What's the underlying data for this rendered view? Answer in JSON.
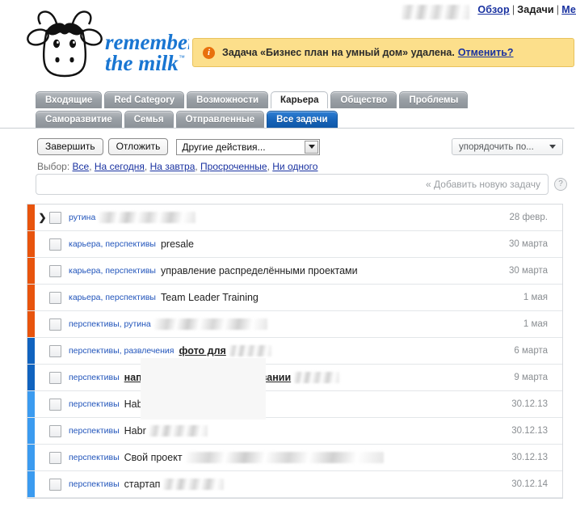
{
  "header": {
    "logo_alt": "remember the milk",
    "logo_line1": "remember",
    "logo_line2": "the milk",
    "username_redacted": "",
    "nav": [
      {
        "label": "Обзор",
        "link": true
      },
      {
        "label": "Задачи",
        "link": false
      },
      {
        "label": "Ме",
        "link": true
      }
    ],
    "nav_separator": "|"
  },
  "notice": {
    "icon": "info-icon",
    "icon_glyph": "i",
    "text": "Задача «Бизнес план на умный дом» удалена.",
    "undo_label": "Отменить?",
    "bg_color": "#fcdf8b",
    "border_color": "#e8c25c",
    "icon_color": "#e8700d"
  },
  "tabs": {
    "row1": [
      {
        "label": "Входящие",
        "state": "normal"
      },
      {
        "label": "Red Category",
        "state": "normal"
      },
      {
        "label": "Возможности",
        "state": "normal"
      },
      {
        "label": "Карьера",
        "state": "active-white"
      },
      {
        "label": "Общество",
        "state": "normal"
      },
      {
        "label": "Проблемы",
        "state": "normal"
      }
    ],
    "row2": [
      {
        "label": "Саморазвитие",
        "state": "normal"
      },
      {
        "label": "Семья",
        "state": "normal"
      },
      {
        "label": "Отправленные",
        "state": "normal"
      },
      {
        "label": "Все задачи",
        "state": "active-blue"
      }
    ],
    "active_color": "#1663b8"
  },
  "toolbar": {
    "complete_label": "Завершить",
    "postpone_label": "Отложить",
    "more_actions_value": "Другие действия...",
    "sort_by_value": "упорядочить по...",
    "selection_prefix": "Выбор:",
    "selection_links": [
      "Все",
      "На сегодня",
      "На завтра",
      "Просроченные",
      "Ни одного"
    ],
    "selection_separator": ","
  },
  "add_task": {
    "value": "",
    "placeholder": "« Добавить новую задачу",
    "help_glyph": "?"
  },
  "tasks": {
    "columns": [
      "tags",
      "name",
      "due"
    ],
    "rows": [
      {
        "priority_color": "#e8540d",
        "chevron": "❯",
        "checked": false,
        "tags": "рутина",
        "name": "",
        "name_bold": false,
        "name_redacted_width": 120,
        "due": "28 февр."
      },
      {
        "priority_color": "#e8540d",
        "chevron": "",
        "checked": false,
        "tags": "карьера, перспективы",
        "name": "presale",
        "name_bold": false,
        "name_redacted_width": 0,
        "due": "30 марта"
      },
      {
        "priority_color": "#e8540d",
        "chevron": "",
        "checked": false,
        "tags": "карьера, перспективы",
        "name": "управление распределёнными проектами",
        "name_bold": false,
        "name_redacted_width": 0,
        "due": "30 марта"
      },
      {
        "priority_color": "#e8540d",
        "chevron": "",
        "checked": false,
        "tags": "карьера, перспективы",
        "name": "Team Leader Training",
        "name_bold": false,
        "name_redacted_width": 0,
        "due": "1 мая"
      },
      {
        "priority_color": "#e8540d",
        "chevron": "",
        "checked": false,
        "tags": "перспективы, рутина",
        "name": "",
        "name_bold": false,
        "name_redacted_width": 140,
        "due": "1 мая"
      },
      {
        "priority_color": "#1063bf",
        "chevron": "",
        "checked": false,
        "tags": "перспективы, развлечения",
        "name": "фото для",
        "name_bold": true,
        "name_redacted_width": 52,
        "due": "6 марта"
      },
      {
        "priority_color": "#1063bf",
        "chevron": "",
        "checked": false,
        "tags": "перспективы",
        "name": "написать статью о тестировании",
        "name_bold": true,
        "name_redacted_width": 56,
        "due": "9 марта"
      },
      {
        "priority_color": "#3b9bf0",
        "chevron": "",
        "checked": false,
        "tags": "перспективы",
        "name": "Habr",
        "name_bold": false,
        "name_redacted_width": 80,
        "due": "30.12.13"
      },
      {
        "priority_color": "#3b9bf0",
        "chevron": "",
        "checked": false,
        "tags": "перспективы",
        "name": "Habr",
        "name_bold": false,
        "name_redacted_width": 72,
        "due": "30.12.13"
      },
      {
        "priority_color": "#3b9bf0",
        "chevron": "",
        "checked": false,
        "tags": "перспективы",
        "name": "Свой проект",
        "name_bold": false,
        "name_redacted_width": 245,
        "due": "30.12.13"
      },
      {
        "priority_color": "#3b9bf0",
        "chevron": "",
        "checked": false,
        "tags": "перспективы",
        "name": "стартап",
        "name_bold": false,
        "name_redacted_width": 75,
        "due": "30.12.14"
      }
    ]
  },
  "colors": {
    "priority_high": "#e8540d",
    "priority_medium": "#1063bf",
    "priority_low": "#3b9bf0",
    "link": "#1831a0",
    "tag": "#2255bb"
  }
}
